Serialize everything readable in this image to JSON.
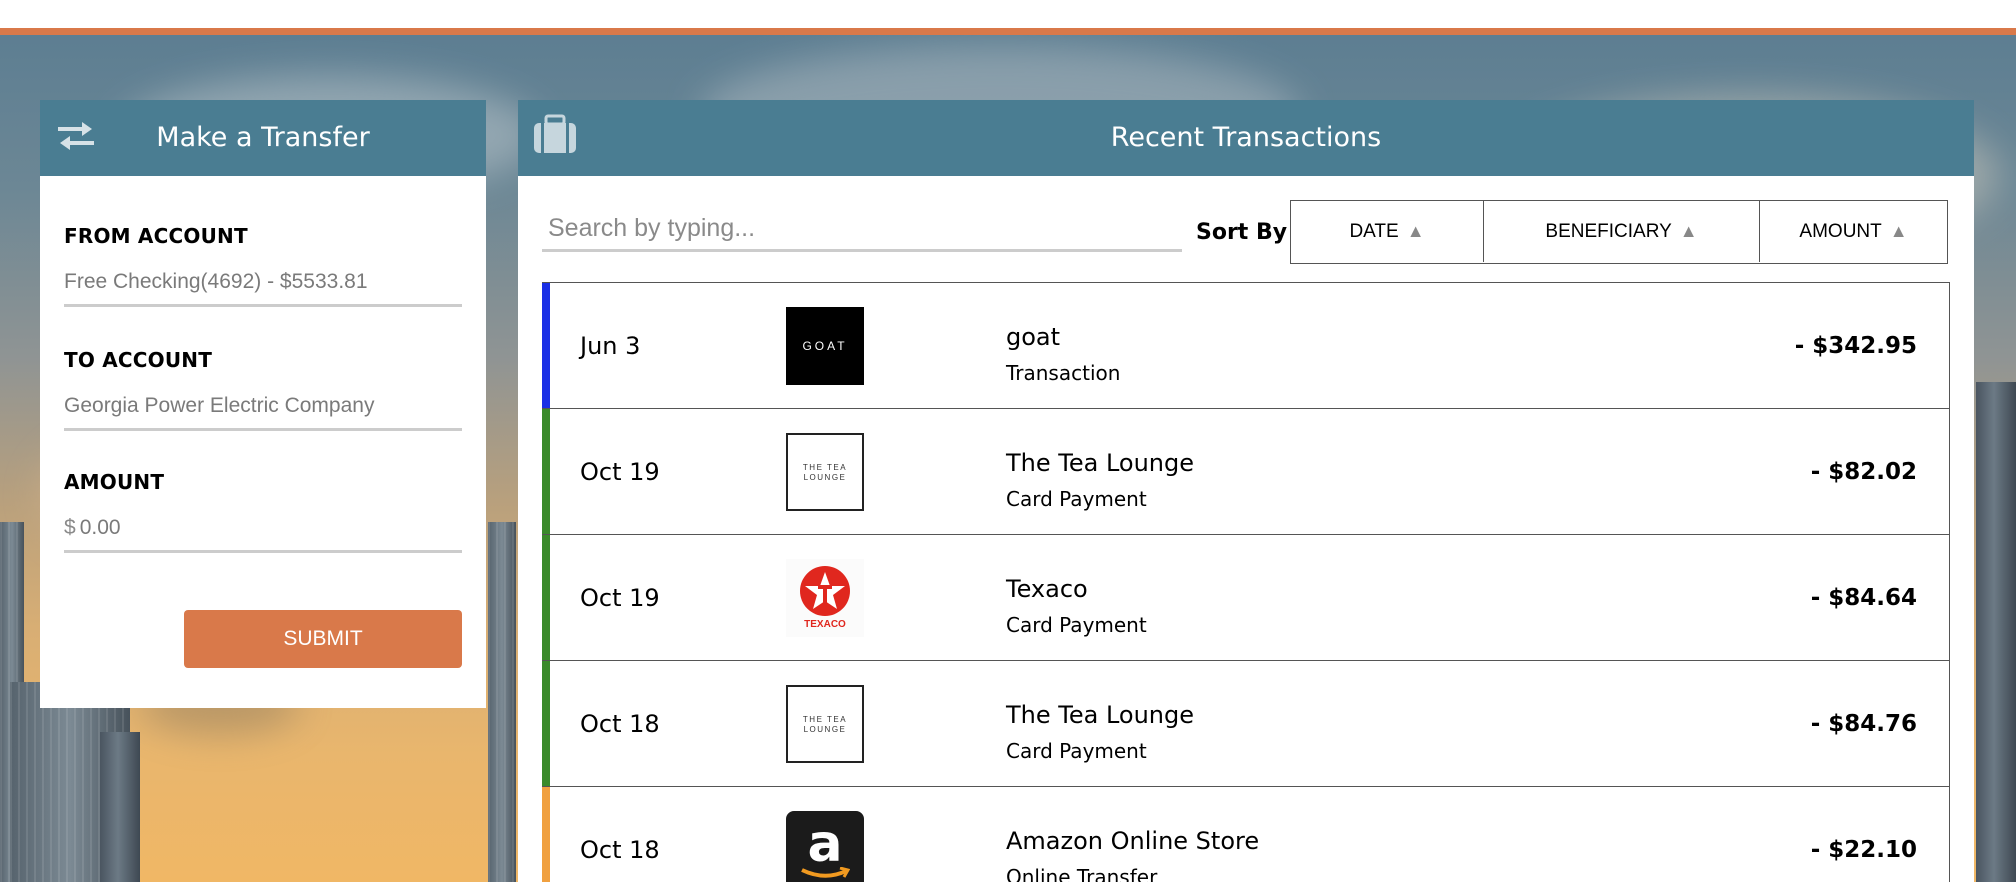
{
  "colors": {
    "accent_orange": "#d9794a",
    "header_teal": "#4a7d92"
  },
  "transfer": {
    "title": "Make a Transfer",
    "icon": "transfer-arrows-icon",
    "from_label": "FROM ACCOUNT",
    "from_value": "Free Checking(4692) - $5533.81",
    "to_label": "TO ACCOUNT",
    "to_value": "Georgia Power Electric Company",
    "amount_label": "AMOUNT",
    "amount_currency": "$",
    "amount_placeholder": "0.00",
    "submit_label": "SUBMIT"
  },
  "transactions": {
    "title": "Recent Transactions",
    "icon": "briefcase-icon",
    "search_placeholder": "Search by typing...",
    "sort_label": "Sort By",
    "sort_options": [
      {
        "label": "DATE",
        "arrow": "▲"
      },
      {
        "label": "BENEFICIARY",
        "arrow": "▲"
      },
      {
        "label": "AMOUNT",
        "arrow": "▲"
      }
    ],
    "rows": [
      {
        "date": "Jun 3",
        "name": "goat",
        "type": "Transaction",
        "amount": "- $342.95",
        "accent": "#1a2fe6",
        "logo": "goat-logo",
        "logo_text": "GOAT"
      },
      {
        "date": "Oct 19",
        "name": "The Tea Lounge",
        "type": "Card Payment",
        "amount": "- $82.02",
        "accent": "#3a8a2a",
        "logo": "tea-lounge-logo",
        "logo_text": "THE TEA LOUNGE"
      },
      {
        "date": "Oct 19",
        "name": "Texaco",
        "type": "Card Payment",
        "amount": "- $84.64",
        "accent": "#3a8a2a",
        "logo": "texaco-logo",
        "logo_text": "TEXACO"
      },
      {
        "date": "Oct 18",
        "name": "The Tea Lounge",
        "type": "Card Payment",
        "amount": "- $84.76",
        "accent": "#3a8a2a",
        "logo": "tea-lounge-logo",
        "logo_text": "THE TEA LOUNGE"
      },
      {
        "date": "Oct 18",
        "name": "Amazon Online Store",
        "type": "Online Transfer",
        "amount": "- $22.10",
        "accent": "#f0a040",
        "logo": "amazon-logo",
        "logo_text": "a"
      }
    ]
  }
}
